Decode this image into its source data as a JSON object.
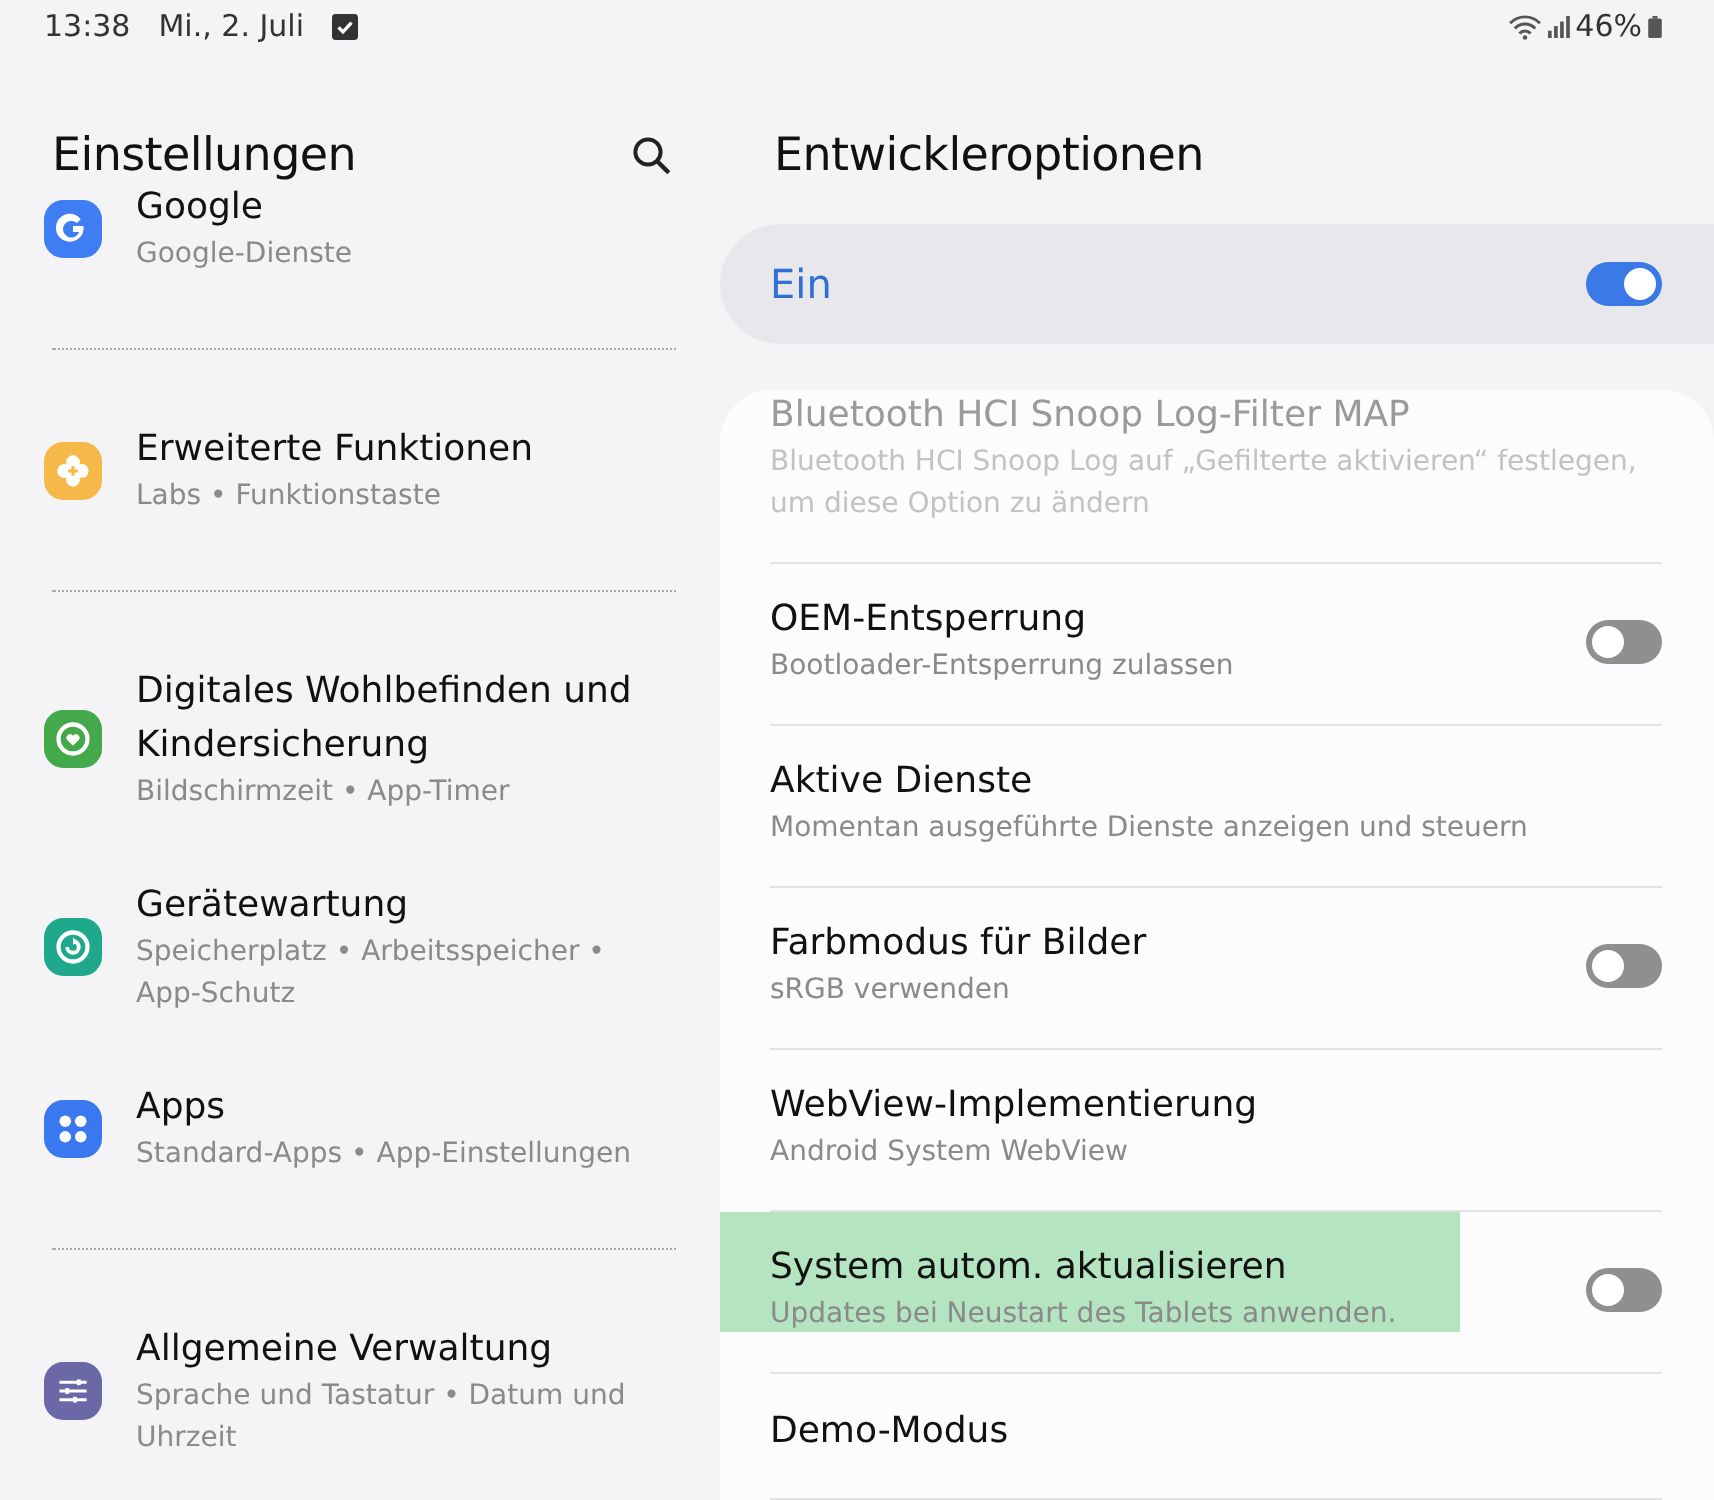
{
  "status_bar": {
    "time": "13:38",
    "date": "Mi., 2. Juli",
    "battery": "46%"
  },
  "sidebar": {
    "title": "Einstellungen",
    "groups": [
      [
        {
          "kind": "google",
          "color": "#3f7ef2",
          "title": "Google",
          "subtitle": "Google-Dienste"
        }
      ],
      [
        {
          "kind": "plus-flower",
          "color": "#f7b84a",
          "title": "Erweiterte Funktionen",
          "subtitle": "Labs • Funktionstaste"
        }
      ],
      [
        {
          "kind": "heart-ring",
          "color": "#43a94a",
          "title": "Digitales Wohlbefinden und Kindersicherung",
          "subtitle": "Bildschirmzeit • App-Timer"
        },
        {
          "kind": "refresh-ring",
          "color": "#1fa88c",
          "title": "Gerätewartung",
          "subtitle": "Speicherplatz • Arbeitsspeicher • App-Schutz"
        },
        {
          "kind": "grid",
          "color": "#3a78ef",
          "title": "Apps",
          "subtitle": "Standard-Apps • App-Einstellungen"
        }
      ],
      [
        {
          "kind": "sliders",
          "color": "#6b68a8",
          "title": "Allgemeine Verwaltung",
          "subtitle": "Sprache und Tastatur • Datum und Uhrzeit"
        }
      ]
    ]
  },
  "main": {
    "title": "Entwickleroptionen",
    "master": {
      "label": "Ein",
      "on": true
    },
    "options": [
      {
        "title": "Bluetooth HCI Snoop Log-Filter MAP",
        "subtitle": "Bluetooth HCI Snoop Log auf „Gefilterte aktivieren“ festlegen, um diese Option zu ändern",
        "disabled": true,
        "highlighted": false
      },
      {
        "title": "OEM-Entsperrung",
        "subtitle": "Bootloader-Entsperrung zulassen",
        "toggle": {
          "on": false
        },
        "disabled": false,
        "highlighted": false
      },
      {
        "title": "Aktive Dienste",
        "subtitle": "Momentan ausgeführte Dienste anzeigen und steuern",
        "disabled": false,
        "highlighted": false
      },
      {
        "title": "Farbmodus für Bilder",
        "subtitle": "sRGB verwenden",
        "toggle": {
          "on": false
        },
        "disabled": false,
        "highlighted": false
      },
      {
        "title": "WebView-Implementierung",
        "subtitle": "Android System WebView",
        "disabled": false,
        "highlighted": false
      },
      {
        "title": "System autom. aktualisieren",
        "subtitle": "Updates bei Neustart des Tablets anwenden.",
        "toggle": {
          "on": false
        },
        "disabled": false,
        "highlighted": true
      },
      {
        "title": "Demo-Modus",
        "disabled": false,
        "highlighted": false
      }
    ]
  }
}
